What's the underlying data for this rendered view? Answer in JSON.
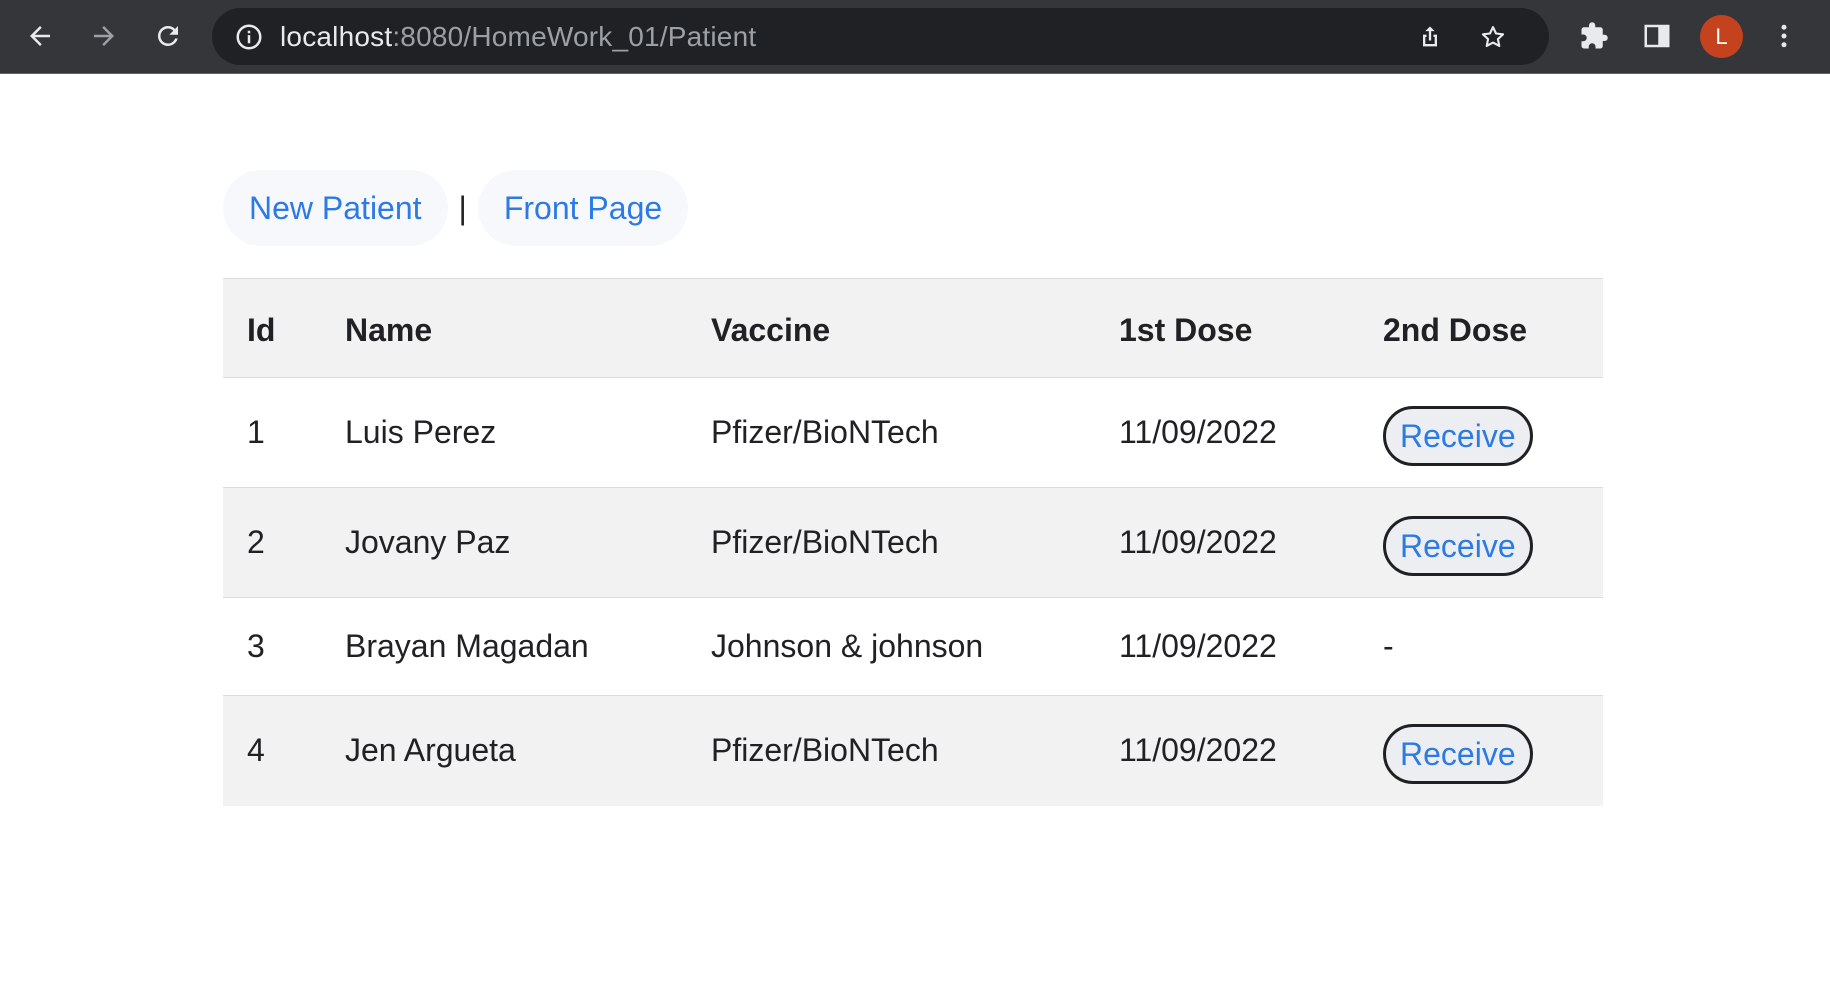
{
  "browser": {
    "url_host": "localhost",
    "url_rest": ":8080/HomeWork_01/Patient",
    "avatar_letter": "L",
    "avatar_color": "#c5421f",
    "icons": [
      "back-arrow-icon",
      "forward-arrow-icon",
      "reload-icon",
      "info-icon",
      "share-icon",
      "star-icon",
      "extensions-icon",
      "side-panel-icon",
      "kebab-menu-icon"
    ]
  },
  "nav": {
    "new_patient": "New Patient",
    "separator": "|",
    "front_page": "Front Page"
  },
  "table": {
    "headers": [
      "Id",
      "Name",
      "Vaccine",
      "1st Dose",
      "2nd Dose"
    ],
    "rows": [
      {
        "id": "1",
        "name": "Luis Perez",
        "vaccine": "Pfizer/BioNTech",
        "dose1": "11/09/2022",
        "dose2": "Receive"
      },
      {
        "id": "2",
        "name": "Jovany Paz",
        "vaccine": "Pfizer/BioNTech",
        "dose1": "11/09/2022",
        "dose2": "Receive"
      },
      {
        "id": "3",
        "name": "Brayan Magadan",
        "vaccine": "Johnson & johnson",
        "dose1": "11/09/2022",
        "dose2": "-"
      },
      {
        "id": "4",
        "name": "Jen Argueta",
        "vaccine": "Pfizer/BioNTech",
        "dose1": "11/09/2022",
        "dose2": "Receive"
      }
    ]
  },
  "colors": {
    "link": "#2c7ae6",
    "toolbar_bg": "#35363a",
    "row_alt_bg": "#f2f2f2"
  }
}
